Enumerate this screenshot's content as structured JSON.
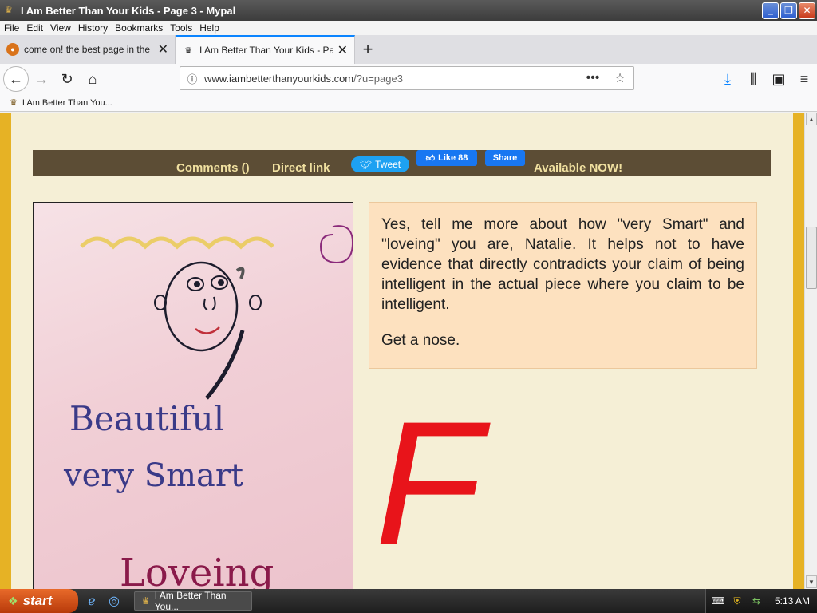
{
  "window": {
    "title": "I Am Better Than Your Kids - Page 3 - Mypal"
  },
  "menu": [
    "File",
    "Edit",
    "View",
    "History",
    "Bookmarks",
    "Tools",
    "Help"
  ],
  "tabs": [
    {
      "label": "come on! the best page in the uni"
    },
    {
      "label": "I Am Better Than Your Kids - Page"
    }
  ],
  "urlbar": {
    "url_host": "www.iambetterthanyourkids.com",
    "url_path": "/?u=page3"
  },
  "bookmarks": [
    {
      "label": "I Am Better Than You..."
    }
  ],
  "sharebar": {
    "comments": "Comments ()",
    "direct_link": "Direct link",
    "tweet": "Tweet",
    "like": "Like 88",
    "share": "Share",
    "available": "Available NOW!"
  },
  "drawing": {
    "line1": "Beautiful",
    "line2": "very Smart",
    "line3": "Loveing"
  },
  "comment": {
    "p1": "Yes, tell me more about how \"very Smart\" and \"loveing\" you are, Natalie. It helps not to have evidence that directly contradicts your claim of being intelligent in the actual piece where you claim to be intelligent.",
    "p2": "Get a nose."
  },
  "grade": "F",
  "taskbar": {
    "start": "start",
    "window_item": "I Am Better Than You...",
    "clock": "5:13 AM"
  },
  "colors": {
    "page_bg": "#f5efd6",
    "border_gold": "#e6b225",
    "sharebar_bg": "#5c4d35",
    "comment_bg": "#fde1bf",
    "grade_red": "#e8141a"
  }
}
